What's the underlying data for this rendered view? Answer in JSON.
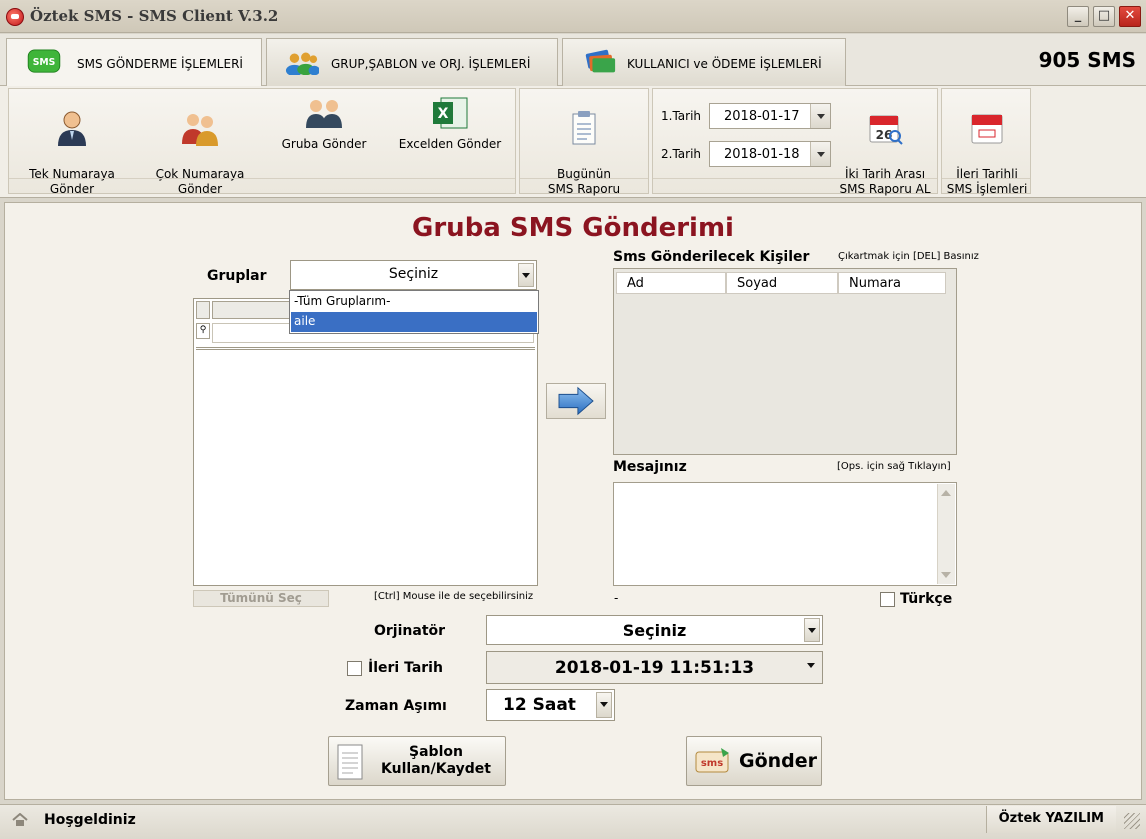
{
  "window": {
    "title": "Öztek SMS - SMS Client  V.3.2",
    "minimize_glyph": "_",
    "maximize_glyph": "□",
    "close_glyph": "✕"
  },
  "tabs": [
    {
      "label": "SMS GÖNDERME İŞLEMLERİ",
      "icon": "sms-bubble-icon",
      "active": true
    },
    {
      "label": "GRUP,ŞABLON ve ORJ. İŞLEMLERİ",
      "icon": "group-icon",
      "active": false
    },
    {
      "label": "KULLANICI ve ÖDEME İŞLEMLERİ",
      "icon": "cards-icon",
      "active": false
    }
  ],
  "sms_balance": "905 SMS",
  "toolbar": {
    "send_single": "Tek Numaraya\nGönder",
    "send_multi": "Çok Numaraya\nGönder",
    "send_group": "Gruba Gönder",
    "send_excel": "Excelden Gönder",
    "today_report": "Bugünün\nSMS Raporu",
    "date1_label": "1.Tarih",
    "date1_value": "2018-01-17",
    "date2_label": "2.Tarih",
    "date2_value": "2018-01-18",
    "range_report": "İki Tarih Arası\nSMS Raporu AL",
    "calendar_day": "26",
    "future_ops": "İleri Tarihli\nSMS İşlemleri"
  },
  "main": {
    "title": "Gruba SMS Gönderimi",
    "groups_label": "Gruplar",
    "groups_select": "Seçiniz",
    "groups_options": [
      "-Tüm Gruplarım-",
      "aile"
    ],
    "select_all": "Tümünü Seç",
    "ctrl_hint": "[Ctrl] Mouse ile de seçebilirsiniz",
    "recipients_label": "Sms Gönderilecek Kişiler",
    "remove_hint": "Çıkartmak için [DEL] Basınız",
    "columns": [
      "Ad",
      "Soyad",
      "Numara"
    ],
    "message_label": "Mesajınız",
    "message_hint": "[Ops. için sağ Tıklayın]",
    "char_count": "-",
    "turkish_label": "Türkçe",
    "originator_label": "Orjinatör",
    "originator_value": "Seçiniz",
    "future_date_label": "İleri Tarih",
    "future_date_value": "2018-01-19 11:51:13",
    "timeout_label": "Zaman Aşımı",
    "timeout_value": "12 Saat",
    "template_button": "Şablon\nKullan/Kaydet",
    "send_button": "Gönder",
    "send_icon_text": "sms"
  },
  "status": {
    "text": "Hoşgeldiniz",
    "company": "Öztek YAZILIM"
  }
}
